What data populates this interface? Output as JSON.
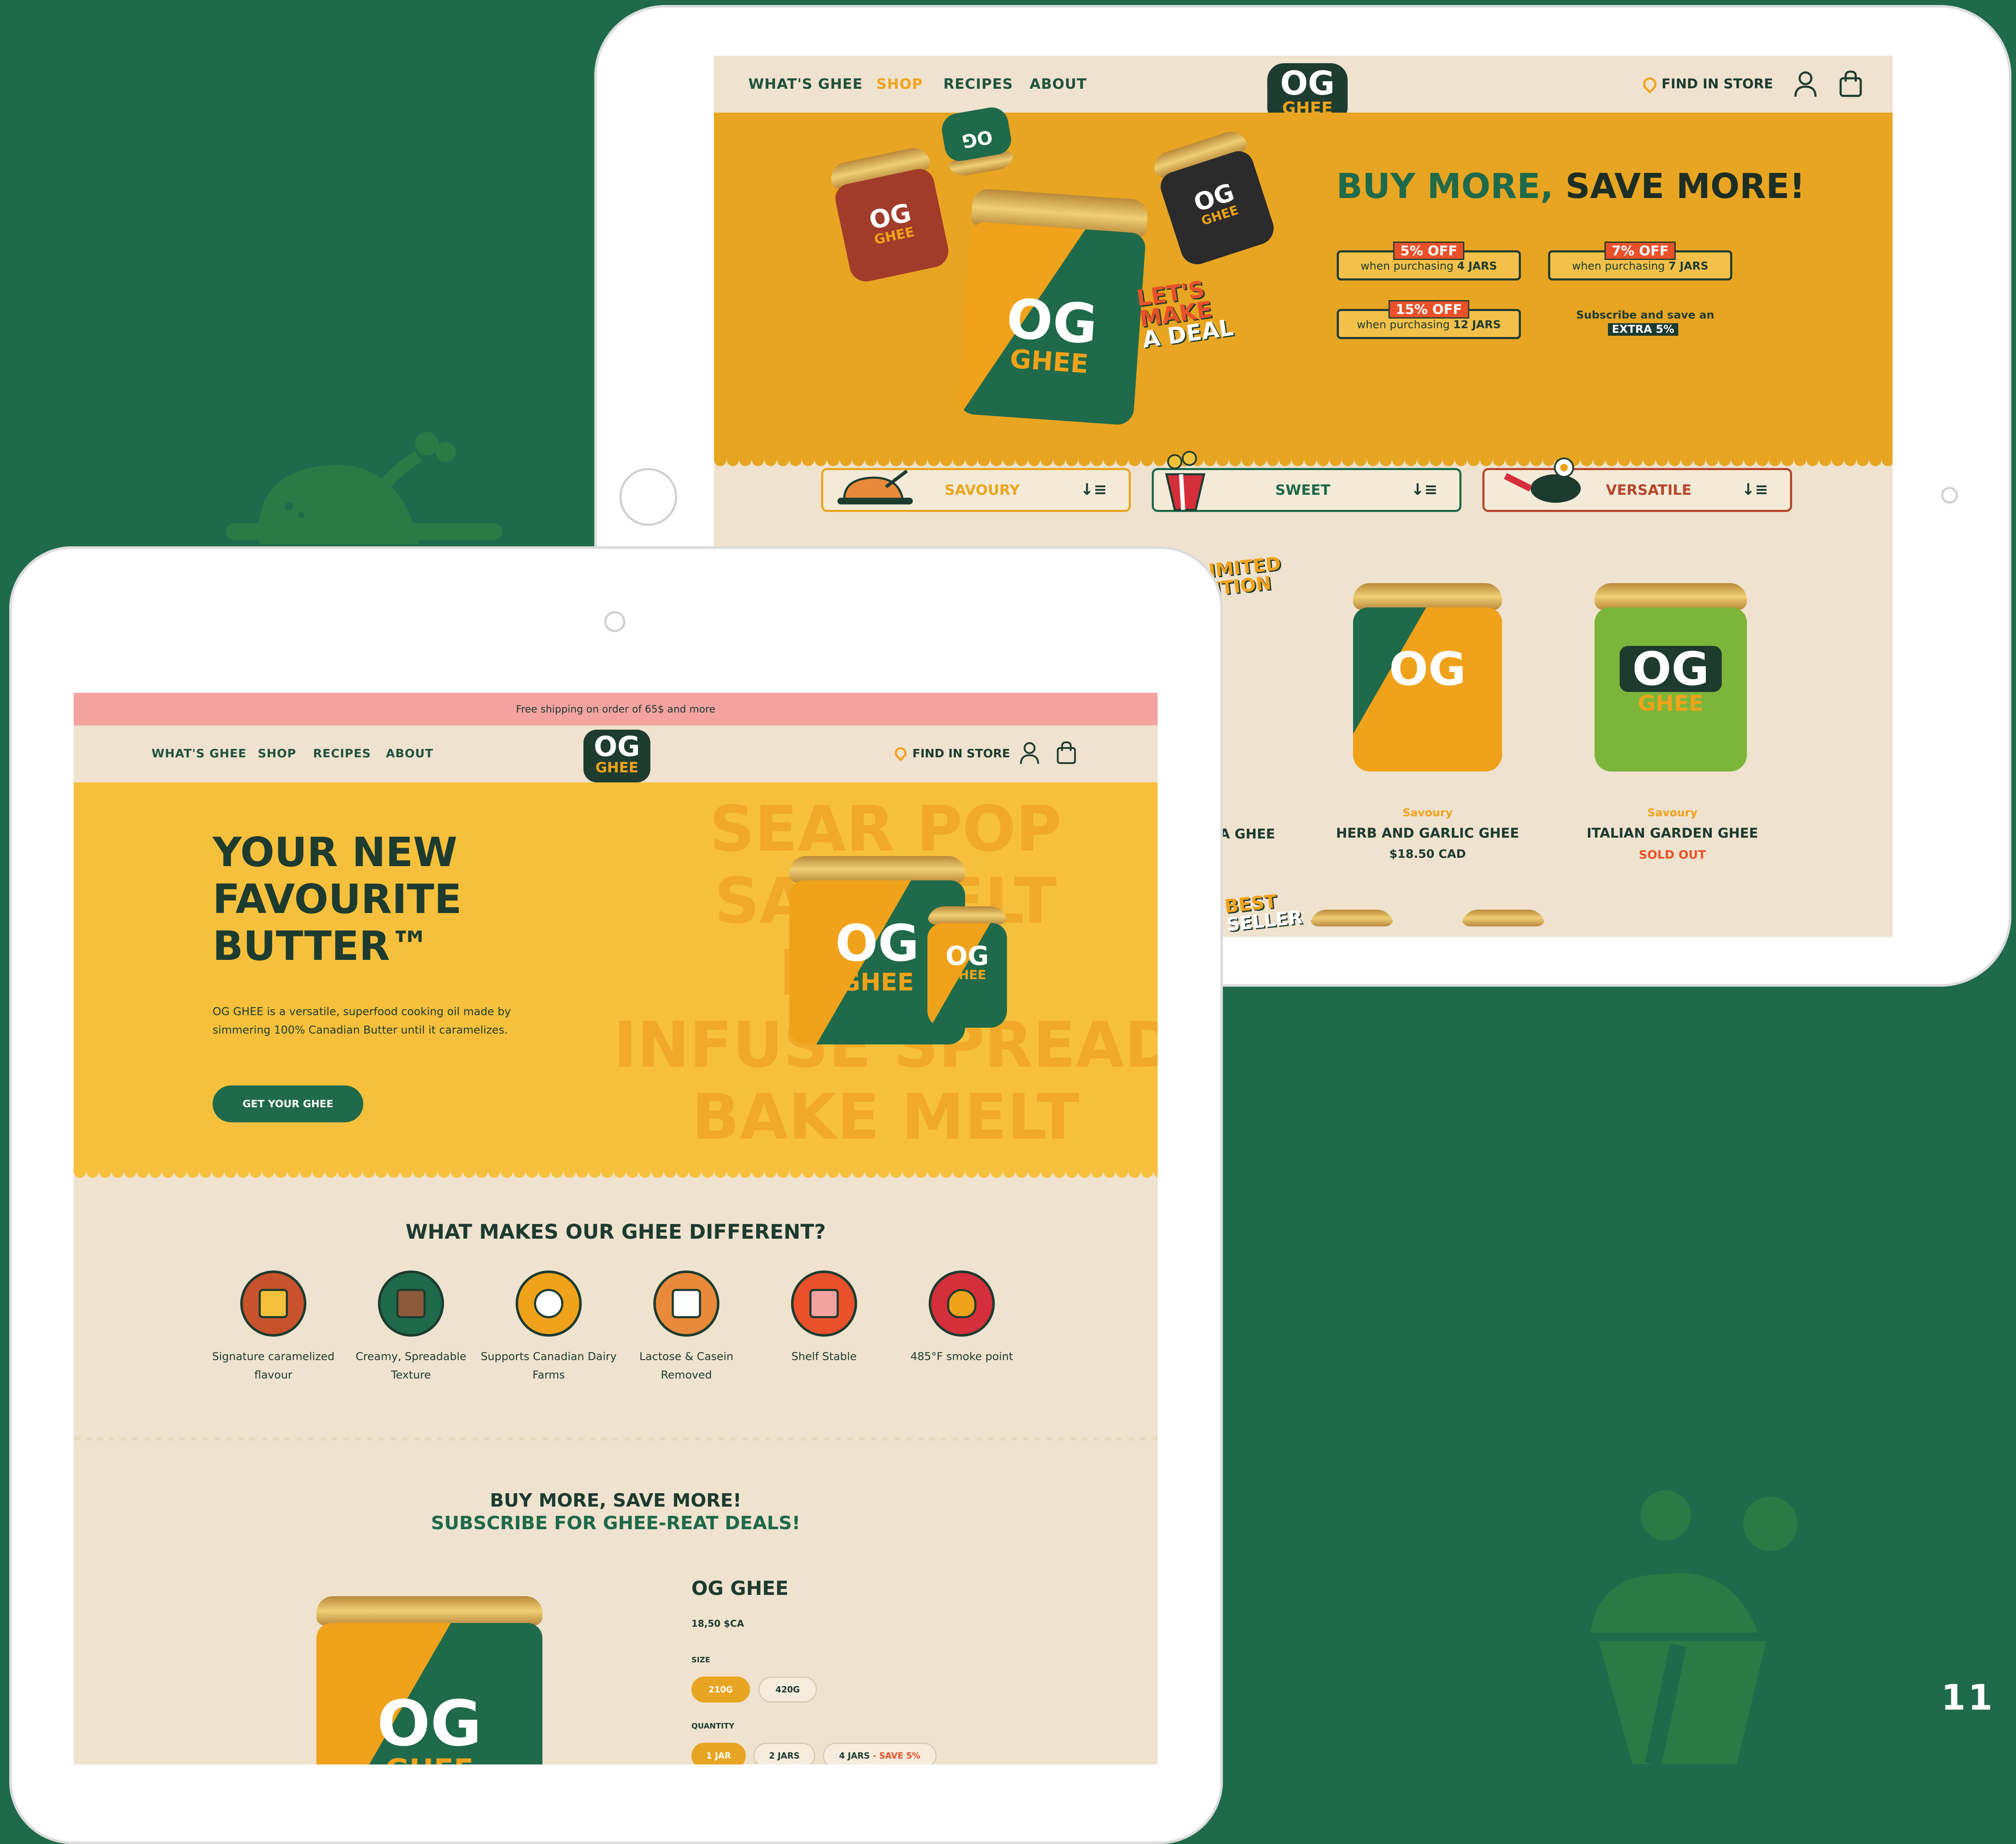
{
  "page_number": "11",
  "colors": {
    "background": "#1f6a4a",
    "accent_yellow": "#e8a521",
    "dark_green": "#1d3b2e",
    "orange": "#e8512a",
    "cream": "#efe3d0"
  },
  "nav": {
    "items": [
      "WHAT'S GHEE",
      "SHOP",
      "RECIPES",
      "ABOUT"
    ],
    "active_top": "SHOP",
    "find_in_store": "FIND IN STORE",
    "logo_top": "OG",
    "logo_bottom": "GHEE",
    "icons": [
      "location-pin-icon",
      "user-icon",
      "shopping-bag-icon"
    ]
  },
  "shop_page": {
    "headline_green": "BUY MORE,",
    "headline_dark": "SAVE MORE!",
    "deal_sticker": [
      "LET'S",
      "MAKE",
      "A DEAL"
    ],
    "deals": [
      {
        "off": "5% OFF",
        "when": "when purchasing",
        "qty": "4 JARS"
      },
      {
        "off": "7% OFF",
        "when": "when purchasing",
        "qty": "7 JARS"
      },
      {
        "off": "15% OFF",
        "when": "when purchasing",
        "qty": "12 JARS"
      }
    ],
    "subscribe_line": "Subscribe and save an",
    "subscribe_extra": "EXTRA 5%",
    "filters": [
      {
        "label": "SAVOURY",
        "color": "#e8a521",
        "icon": "roast-chicken-icon"
      },
      {
        "label": "SWEET",
        "color": "#1f6a4a",
        "icon": "popcorn-icon"
      },
      {
        "label": "VERSATILE",
        "color": "#b5452c",
        "icon": "frying-pan-icon"
      }
    ],
    "sort_glyph": "↓≡",
    "limited_sticker": [
      "LIMITED",
      "DITION"
    ],
    "best_seller_sticker": [
      "BEST",
      "SELLER"
    ],
    "products": [
      {
        "category": "",
        "name": "A GHEE",
        "price": ""
      },
      {
        "category": "Savoury",
        "name": "HERB AND GARLIC GHEE",
        "price": "$18.50 CAD"
      },
      {
        "category": "Savoury",
        "name": "ITALIAN GARDEN GHEE",
        "status": "SOLD OUT"
      }
    ]
  },
  "home_page": {
    "banner": "Free shipping on order of 65$ and more",
    "hero_title": [
      "YOUR NEW",
      "FAVOURITE",
      "BUTTER™"
    ],
    "hero_desc": "OG GHEE is a versatile, superfood cooking oil made by simmering 100% Canadian Butter until it caramelizes.",
    "cta": "GET YOUR GHEE",
    "bg_words": [
      "SEAR POP",
      "SAU      MELT",
      "RO         RY",
      "INFUSE SPREAD",
      "BAKE MELT"
    ],
    "different_title": "WHAT MAKES OUR GHEE DIFFERENT?",
    "features": [
      {
        "label": "Signature caramelized flavour",
        "icon": "butter-block-icon",
        "color": "#c8522b"
      },
      {
        "label": "Creamy, Spreadable Texture",
        "icon": "spread-knife-icon",
        "color": "#1f6a4a"
      },
      {
        "label": "Supports Canadian Dairy Farms",
        "icon": "cow-icon",
        "color": "#f0a21b"
      },
      {
        "label": "Lactose & Casein Removed",
        "icon": "milk-carton-icon",
        "color": "#e88a3a"
      },
      {
        "label": "Shelf Stable",
        "icon": "jar-icon",
        "color": "#e8512a"
      },
      {
        "label": "485°F smoke point",
        "icon": "flame-icon",
        "color": "#d42f3a"
      }
    ],
    "buy_more_title": "BUY MORE, SAVE MORE!",
    "buy_more_sub": "SUBSCRIBE FOR GHEE-REAT DEALS!",
    "product": {
      "name": "OG GHEE",
      "price": "18,50 $CA",
      "size_label": "SIZE",
      "sizes": [
        "210G",
        "420G"
      ],
      "selected_size": "210G",
      "quantity_label": "QUANTITY",
      "quantities": [
        "1 JAR",
        "2 JARS",
        "4 JARS"
      ],
      "quantity_save": "- SAVE 5%",
      "selected_quantity": "1 JAR"
    }
  }
}
